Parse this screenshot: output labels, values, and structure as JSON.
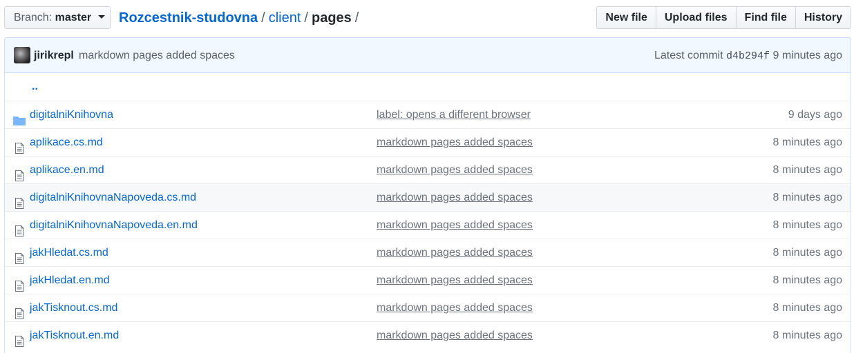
{
  "branch": {
    "label": "Branch:",
    "value": "master"
  },
  "breadcrumb": {
    "repo": "Rozcestnik-studovna",
    "sep1": "/",
    "folder": "client",
    "sep2": "/",
    "current": "pages",
    "sep3": "/"
  },
  "actions": {
    "new_file": "New file",
    "upload_files": "Upload files",
    "find_file": "Find file",
    "history": "History"
  },
  "commit": {
    "author": "jirikrepl",
    "message": "markdown pages added spaces",
    "latest_label": "Latest commit",
    "sha": "d4b294f",
    "age": "9 minutes ago"
  },
  "parent_link": "..",
  "files": [
    {
      "name": "digitalniKnihovna",
      "type": "folder",
      "message": "label: opens a different browser",
      "age": "9 days ago"
    },
    {
      "name": "aplikace.cs.md",
      "type": "file",
      "message": "markdown pages added spaces",
      "age": "8 minutes ago"
    },
    {
      "name": "aplikace.en.md",
      "type": "file",
      "message": "markdown pages added spaces",
      "age": "8 minutes ago"
    },
    {
      "name": "digitalniKnihovnaNapoveda.cs.md",
      "type": "file",
      "message": "markdown pages added spaces",
      "age": "8 minutes ago"
    },
    {
      "name": "digitalniKnihovnaNapoveda.en.md",
      "type": "file",
      "message": "markdown pages added spaces",
      "age": "8 minutes ago"
    },
    {
      "name": "jakHledat.cs.md",
      "type": "file",
      "message": "markdown pages added spaces",
      "age": "8 minutes ago"
    },
    {
      "name": "jakHledat.en.md",
      "type": "file",
      "message": "markdown pages added spaces",
      "age": "8 minutes ago"
    },
    {
      "name": "jakTisknout.cs.md",
      "type": "file",
      "message": "markdown pages added spaces",
      "age": "8 minutes ago"
    },
    {
      "name": "jakTisknout.en.md",
      "type": "file",
      "message": "markdown pages added spaces",
      "age": "8 minutes ago"
    }
  ],
  "colors": {
    "link": "#0366d6",
    "commit_bg": "#f1f8ff",
    "folder_icon": "#79b8ff",
    "muted": "#6a737d"
  }
}
